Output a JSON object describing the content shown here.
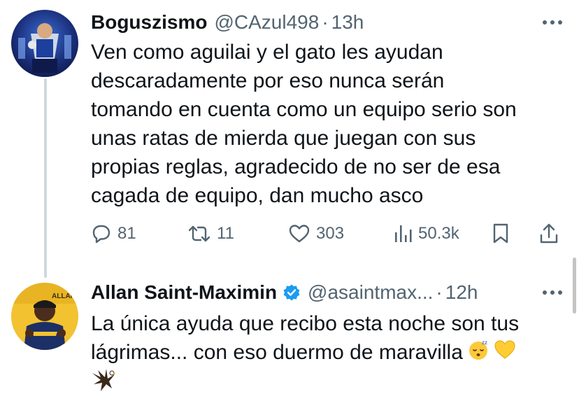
{
  "tweets": [
    {
      "display_name": "Boguszismo",
      "handle": "@CAzul498",
      "separator": "·",
      "time": "13h",
      "text_lines": [
        "Ven como aguilai y el gato les ayudan",
        "descaradamente por eso nunca serán",
        "tomando en cuenta como un equipo serio son",
        "unas ratas de mierda que juegan con sus",
        "propias reglas, agradecido de no ser de esa",
        "cagada de equipo, dan mucho asco"
      ],
      "replies": "81",
      "retweets": "11",
      "likes": "303",
      "views": "50.3k",
      "avatar_icon": "profile-photo-trophy"
    },
    {
      "display_name": "Allan Saint-Maximin",
      "verified": true,
      "verified_color": "#1d9bf0",
      "handle": "@asaintmax...",
      "separator": "·",
      "time": "12h",
      "text_lines": [
        "La única ayuda que recibo esta noche son tus",
        "lágrimas... con eso duermo de maravilla"
      ],
      "emojis": [
        "sleeping-face-icon",
        "yellow-heart-icon",
        "eagle-icon"
      ],
      "avatar_icon": "profile-photo-player"
    }
  ],
  "colors": {
    "text": "#0f1419",
    "secondary": "#536471",
    "thread_line": "#cfd9de",
    "accent": "#1d9bf0"
  }
}
